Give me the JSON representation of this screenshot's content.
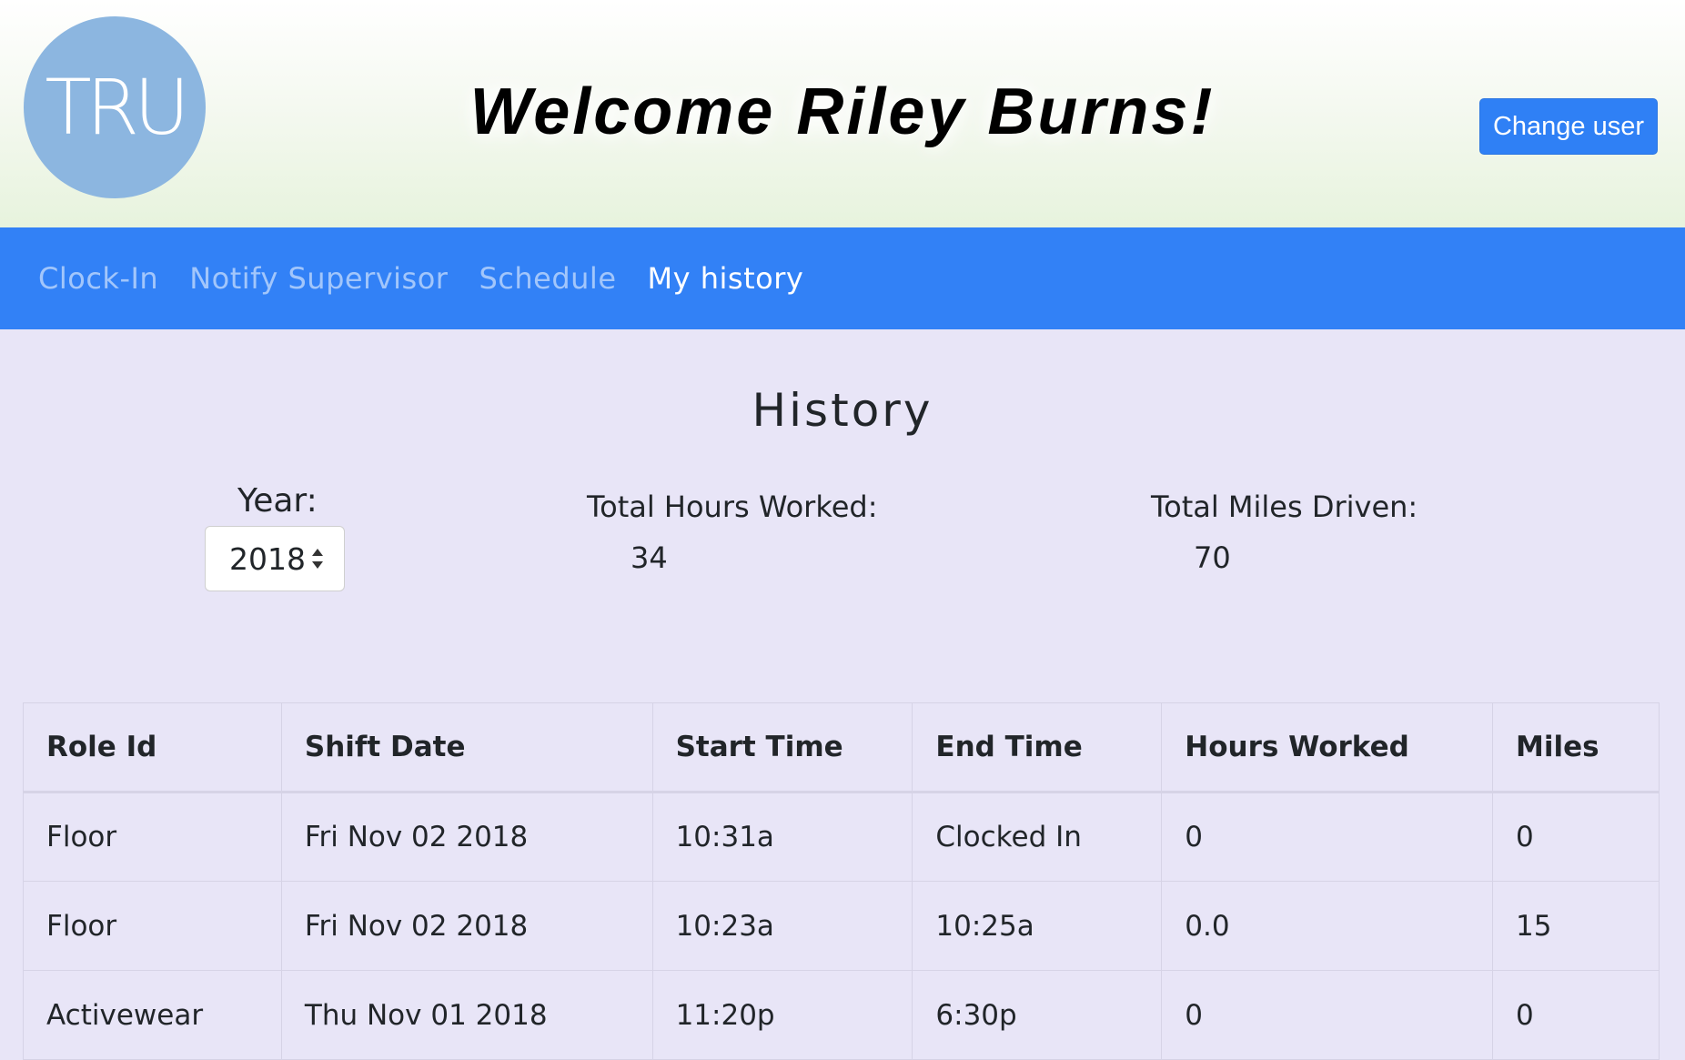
{
  "header": {
    "logo_text": "TRU",
    "welcome": "Welcome Riley Burns!",
    "change_user_label": "Change user"
  },
  "nav": {
    "items": [
      {
        "label": "Clock-In",
        "active": false
      },
      {
        "label": "Notify Supervisor",
        "active": false
      },
      {
        "label": "Schedule",
        "active": false
      },
      {
        "label": "My history",
        "active": true
      }
    ]
  },
  "page": {
    "title": "History"
  },
  "filters": {
    "year_label": "Year:",
    "year_value": "2018"
  },
  "stats": {
    "hours_label": "Total Hours Worked:",
    "hours_value": "34",
    "miles_label": "Total Miles Driven:",
    "miles_value": "70"
  },
  "table": {
    "headers": [
      "Role Id",
      "Shift Date",
      "Start Time",
      "End Time",
      "Hours Worked",
      "Miles"
    ],
    "rows": [
      [
        "Floor",
        "Fri Nov 02 2018",
        "10:31a",
        "Clocked In",
        "0",
        "0"
      ],
      [
        "Floor",
        "Fri Nov 02 2018",
        "10:23a",
        "10:25a",
        "0.0",
        "15"
      ],
      [
        "Activewear",
        "Thu Nov 01 2018",
        "11:20p",
        "6:30p",
        "0",
        "0"
      ]
    ]
  },
  "colors": {
    "accent": "#3281f6",
    "logo": "#8cb6e0",
    "background": "#e8e5f7"
  }
}
